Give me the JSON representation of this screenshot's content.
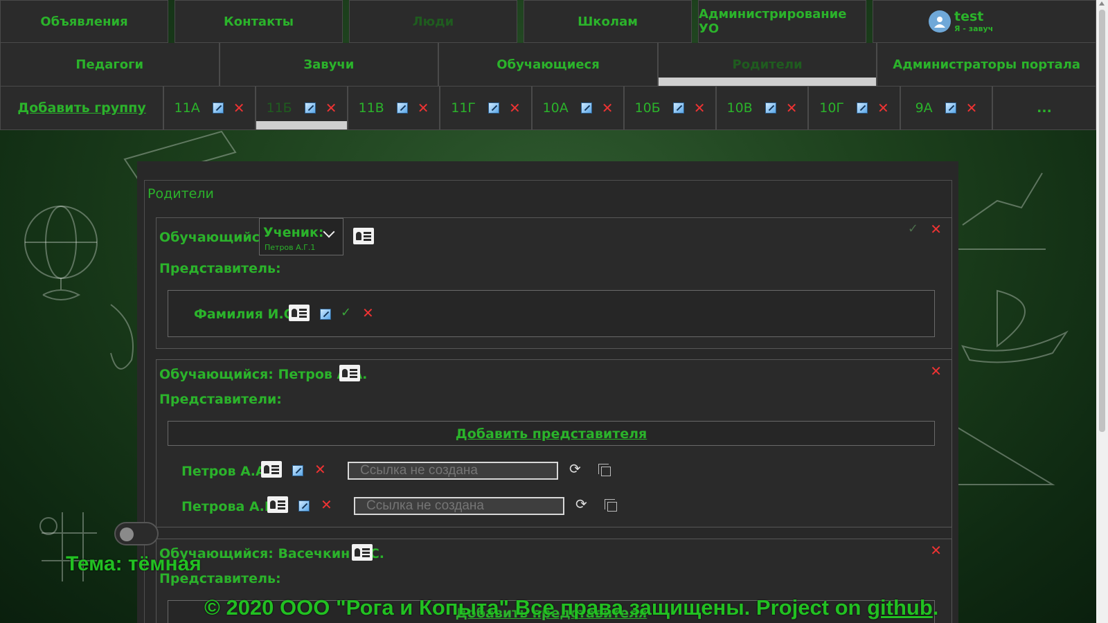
{
  "nav": {
    "top": [
      "Объявления",
      "Контакты",
      "Люди",
      "Школам",
      "Администрирование УО"
    ],
    "user": {
      "name": "test",
      "role": "Я - завуч"
    },
    "people": [
      "Педагоги",
      "Завучи",
      "Обучающиеся",
      "Родители",
      "Администраторы портала"
    ],
    "groups": {
      "add_label": "Добавить группу",
      "items": [
        "11А",
        "11Б",
        "11В",
        "11Г",
        "10А",
        "10Б",
        "10В",
        "10Г",
        "9А"
      ],
      "more": "..."
    }
  },
  "panel": {
    "title": "Родители",
    "card1": {
      "student_label": "Обучающийся:",
      "select_label": "Ученик:",
      "select_value": "Петров А.Г.1",
      "rep_label": "Представитель:",
      "rep_name": "Фамилия И.О."
    },
    "card2": {
      "student_label": "Обучающийся: Петров А.А.",
      "reps_label": "Представители:",
      "add_rep": "Добавить представителя",
      "reps": [
        {
          "name": "Петров А.А.",
          "link_placeholder": "Ссылка не создана"
        },
        {
          "name": "Петрова А.Б.",
          "link_placeholder": "Ссылка не создана"
        }
      ]
    },
    "card3": {
      "student_label": "Обучающийся: Васечкин А.С.",
      "rep_label": "Представитель:",
      "add_rep": "Добавить представителя"
    }
  },
  "theme": {
    "label": "Тема: тёмная"
  },
  "footer": {
    "text": "© 2020 ООО \"Рога и Копыта\" Все права защищены. Project on ",
    "link": "github",
    "end": "."
  },
  "colors": {
    "accent": "#2bb32b",
    "panel": "#2b2b2b",
    "danger": "#ee3333"
  }
}
